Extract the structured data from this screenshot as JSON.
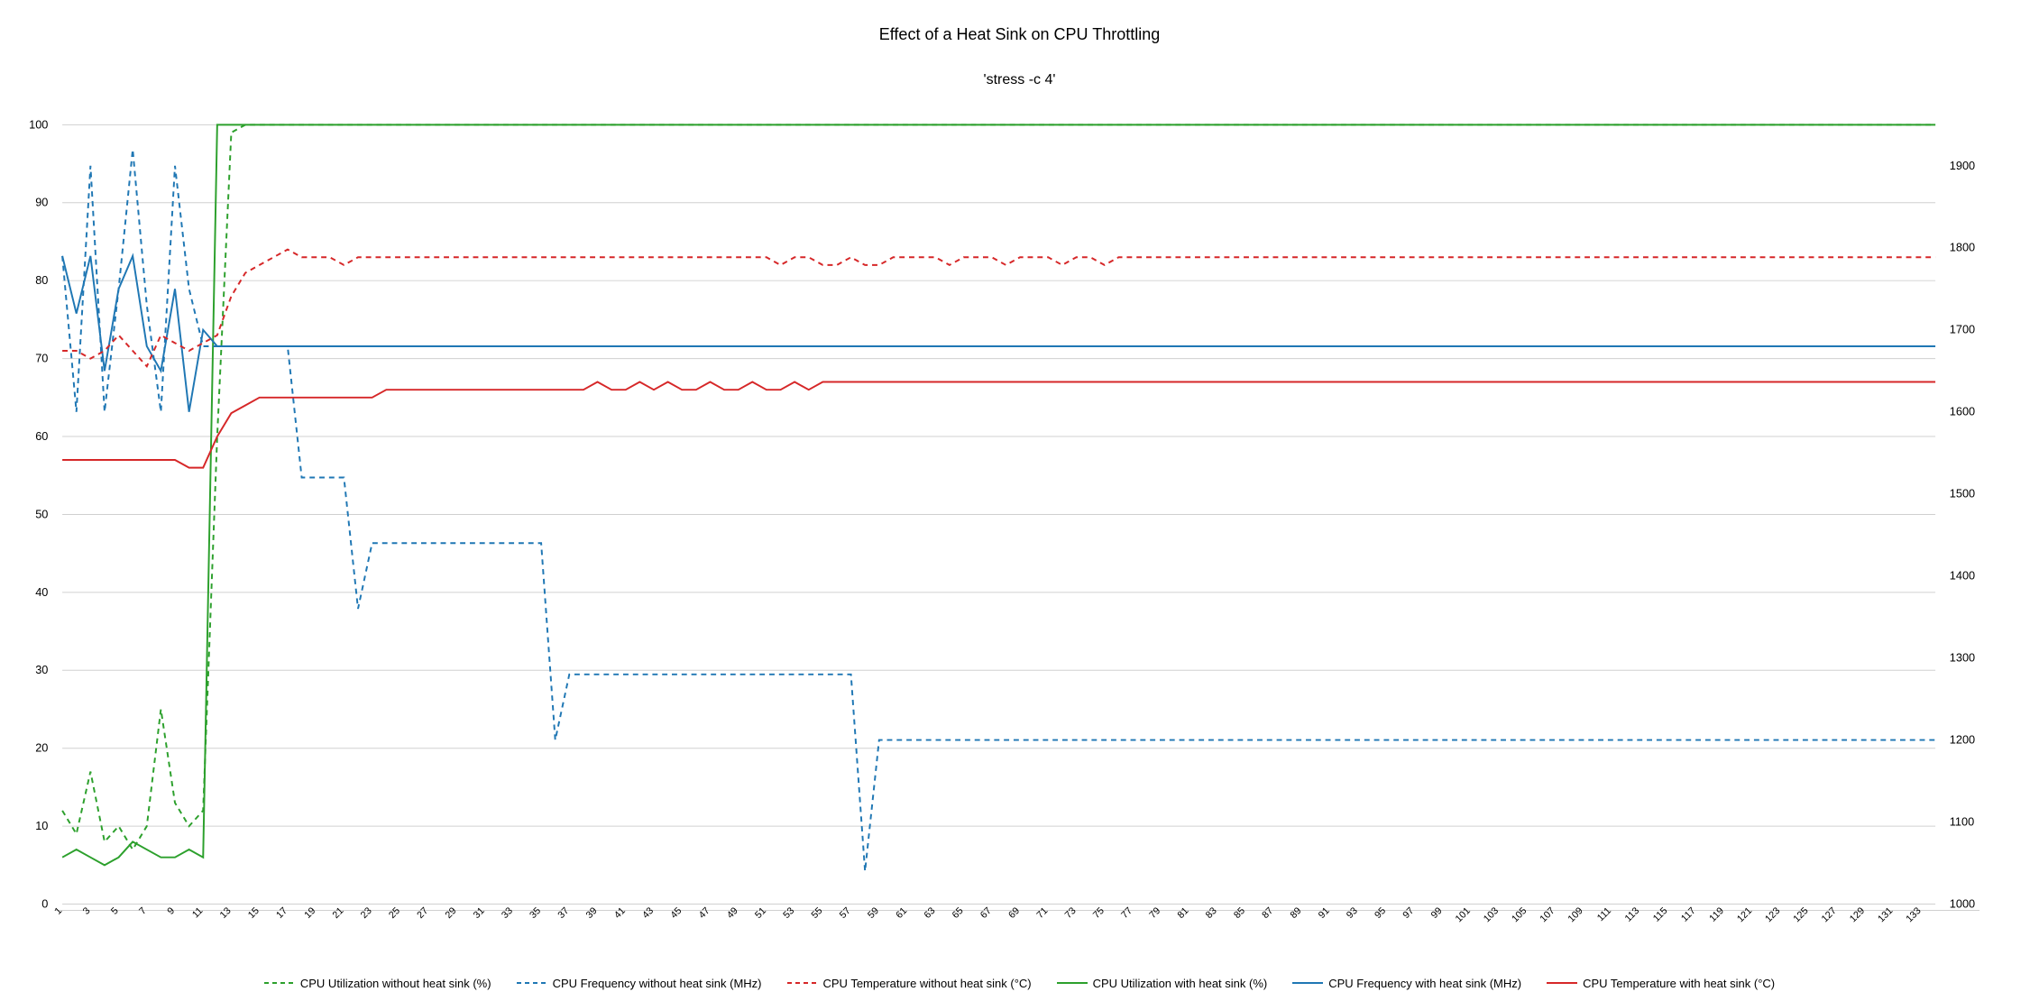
{
  "title": "Effect of a Heat Sink on CPU Throttling",
  "subtitle": "'stress -c 4'",
  "legend": [
    {
      "name": "CPU Utilization without heat sink (%)",
      "color": "#2ca02c",
      "dash": true
    },
    {
      "name": "CPU Frequency without heat sink (MHz)",
      "color": "#1f77b4",
      "dash": true
    },
    {
      "name": "CPU Temperature without heat sink (°C)",
      "color": "#d62728",
      "dash": true
    },
    {
      "name": "CPU Utilization with heat sink (%)",
      "color": "#2ca02c",
      "dash": false
    },
    {
      "name": "CPU Frequency with heat sink (MHz)",
      "color": "#1f77b4",
      "dash": false
    },
    {
      "name": "CPU Temperature with heat sink (°C)",
      "color": "#d62728",
      "dash": false
    }
  ],
  "chart_data": {
    "type": "line",
    "xlabel": "",
    "ylabel_left": "",
    "ylabel_right": "",
    "y_left": {
      "min": 0,
      "max": 100,
      "ticks": [
        0,
        10,
        20,
        30,
        40,
        50,
        60,
        70,
        80,
        90,
        100
      ]
    },
    "y_right": {
      "min": 1000,
      "max": 1950,
      "ticks": [
        1000,
        1100,
        1200,
        1300,
        1400,
        1500,
        1600,
        1700,
        1800,
        1900
      ]
    },
    "x": [
      1,
      2,
      3,
      4,
      5,
      6,
      7,
      8,
      9,
      10,
      11,
      12,
      13,
      14,
      15,
      16,
      17,
      18,
      19,
      20,
      21,
      22,
      23,
      24,
      25,
      26,
      27,
      28,
      29,
      30,
      31,
      32,
      33,
      34,
      35,
      36,
      37,
      38,
      39,
      40,
      41,
      42,
      43,
      44,
      45,
      46,
      47,
      48,
      49,
      50,
      51,
      52,
      53,
      54,
      55,
      56,
      57,
      58,
      59,
      60,
      61,
      62,
      63,
      64,
      65,
      66,
      67,
      68,
      69,
      70,
      71,
      72,
      73,
      74,
      75,
      76,
      77,
      78,
      79,
      80,
      81,
      82,
      83,
      84,
      85,
      86,
      87,
      88,
      89,
      90,
      91,
      92,
      93,
      94,
      95,
      96,
      97,
      98,
      99,
      100,
      101,
      102,
      103,
      104,
      105,
      106,
      107,
      108,
      109,
      110,
      111,
      112,
      113,
      114,
      115,
      116,
      117,
      118,
      119,
      120,
      121,
      122,
      123,
      124,
      125,
      126,
      127,
      128,
      129,
      130,
      131,
      132,
      133,
      134
    ],
    "series": [
      {
        "name": "CPU Utilization without heat sink (%)",
        "axis": "left",
        "color": "#2ca02c",
        "dash": true,
        "values": [
          12,
          9,
          17,
          8,
          10,
          7,
          10,
          25,
          13,
          10,
          12,
          60,
          99,
          100,
          100,
          100,
          100,
          100,
          100,
          100,
          100,
          100,
          100,
          100,
          100,
          100,
          100,
          100,
          100,
          100,
          100,
          100,
          100,
          100,
          100,
          100,
          100,
          100,
          100,
          100,
          100,
          100,
          100,
          100,
          100,
          100,
          100,
          100,
          100,
          100,
          100,
          100,
          100,
          100,
          100,
          100,
          100,
          100,
          100,
          100,
          100,
          100,
          100,
          100,
          100,
          100,
          100,
          100,
          100,
          100,
          100,
          100,
          100,
          100,
          100,
          100,
          100,
          100,
          100,
          100,
          100,
          100,
          100,
          100,
          100,
          100,
          100,
          100,
          100,
          100,
          100,
          100,
          100,
          100,
          100,
          100,
          100,
          100,
          100,
          100,
          100,
          100,
          100,
          100,
          100,
          100,
          100,
          100,
          100,
          100,
          100,
          100,
          100,
          100,
          100,
          100,
          100,
          100,
          100,
          100,
          100,
          100,
          100,
          100,
          100,
          100,
          100,
          100,
          100,
          100,
          100,
          100,
          100,
          100
        ]
      },
      {
        "name": "CPU Utilization with heat sink (%)",
        "axis": "left",
        "color": "#2ca02c",
        "dash": false,
        "values": [
          6,
          7,
          6,
          5,
          6,
          8,
          7,
          6,
          6,
          7,
          6,
          100,
          100,
          100,
          100,
          100,
          100,
          100,
          100,
          100,
          100,
          100,
          100,
          100,
          100,
          100,
          100,
          100,
          100,
          100,
          100,
          100,
          100,
          100,
          100,
          100,
          100,
          100,
          100,
          100,
          100,
          100,
          100,
          100,
          100,
          100,
          100,
          100,
          100,
          100,
          100,
          100,
          100,
          100,
          100,
          100,
          100,
          100,
          100,
          100,
          100,
          100,
          100,
          100,
          100,
          100,
          100,
          100,
          100,
          100,
          100,
          100,
          100,
          100,
          100,
          100,
          100,
          100,
          100,
          100,
          100,
          100,
          100,
          100,
          100,
          100,
          100,
          100,
          100,
          100,
          100,
          100,
          100,
          100,
          100,
          100,
          100,
          100,
          100,
          100,
          100,
          100,
          100,
          100,
          100,
          100,
          100,
          100,
          100,
          100,
          100,
          100,
          100,
          100,
          100,
          100,
          100,
          100,
          100,
          100,
          100,
          100,
          100,
          100,
          100,
          100,
          100,
          100,
          100,
          100,
          100,
          100,
          100,
          100
        ]
      },
      {
        "name": "CPU Frequency without heat sink (MHz)",
        "axis": "right",
        "color": "#1f77b4",
        "dash": true,
        "values": [
          1790,
          1600,
          1900,
          1600,
          1750,
          1920,
          1730,
          1600,
          1900,
          1750,
          1680,
          1680,
          1680,
          1680,
          1680,
          1680,
          1680,
          1520,
          1520,
          1520,
          1520,
          1360,
          1440,
          1440,
          1440,
          1440,
          1440,
          1440,
          1440,
          1440,
          1440,
          1440,
          1440,
          1440,
          1440,
          1200,
          1280,
          1280,
          1280,
          1280,
          1280,
          1280,
          1280,
          1280,
          1280,
          1280,
          1280,
          1280,
          1280,
          1280,
          1280,
          1280,
          1280,
          1280,
          1280,
          1280,
          1280,
          1040,
          1200,
          1200,
          1200,
          1200,
          1200,
          1200,
          1200,
          1200,
          1200,
          1200,
          1200,
          1200,
          1200,
          1200,
          1200,
          1200,
          1200,
          1200,
          1200,
          1200,
          1200,
          1200,
          1200,
          1200,
          1200,
          1200,
          1200,
          1200,
          1200,
          1200,
          1200,
          1200,
          1200,
          1200,
          1200,
          1200,
          1200,
          1200,
          1200,
          1200,
          1200,
          1200,
          1200,
          1200,
          1200,
          1200,
          1200,
          1200,
          1200,
          1200,
          1200,
          1200,
          1200,
          1200,
          1200,
          1200,
          1200,
          1200,
          1200,
          1200,
          1200,
          1200,
          1200,
          1200,
          1200,
          1200,
          1200,
          1200,
          1200,
          1200,
          1200,
          1200,
          1200,
          1200,
          1200,
          1200
        ]
      },
      {
        "name": "CPU Frequency with heat sink (MHz)",
        "axis": "right",
        "color": "#1f77b4",
        "dash": false,
        "values": [
          1790,
          1720,
          1790,
          1650,
          1750,
          1790,
          1680,
          1650,
          1750,
          1600,
          1700,
          1680,
          1680,
          1680,
          1680,
          1680,
          1680,
          1680,
          1680,
          1680,
          1680,
          1680,
          1680,
          1680,
          1680,
          1680,
          1680,
          1680,
          1680,
          1680,
          1680,
          1680,
          1680,
          1680,
          1680,
          1680,
          1680,
          1680,
          1680,
          1680,
          1680,
          1680,
          1680,
          1680,
          1680,
          1680,
          1680,
          1680,
          1680,
          1680,
          1680,
          1680,
          1680,
          1680,
          1680,
          1680,
          1680,
          1680,
          1680,
          1680,
          1680,
          1680,
          1680,
          1680,
          1680,
          1680,
          1680,
          1680,
          1680,
          1680,
          1680,
          1680,
          1680,
          1680,
          1680,
          1680,
          1680,
          1680,
          1680,
          1680,
          1680,
          1680,
          1680,
          1680,
          1680,
          1680,
          1680,
          1680,
          1680,
          1680,
          1680,
          1680,
          1680,
          1680,
          1680,
          1680,
          1680,
          1680,
          1680,
          1680,
          1680,
          1680,
          1680,
          1680,
          1680,
          1680,
          1680,
          1680,
          1680,
          1680,
          1680,
          1680,
          1680,
          1680,
          1680,
          1680,
          1680,
          1680,
          1680,
          1680,
          1680,
          1680,
          1680,
          1680,
          1680,
          1680,
          1680,
          1680,
          1680,
          1680,
          1680,
          1680,
          1680,
          1680
        ]
      },
      {
        "name": "CPU Temperature without heat sink (°C)",
        "axis": "left",
        "color": "#d62728",
        "dash": true,
        "values": [
          71,
          71,
          70,
          71,
          73,
          71,
          69,
          73,
          72,
          71,
          72,
          73,
          78,
          81,
          82,
          83,
          84,
          83,
          83,
          83,
          82,
          83,
          83,
          83,
          83,
          83,
          83,
          83,
          83,
          83,
          83,
          83,
          83,
          83,
          83,
          83,
          83,
          83,
          83,
          83,
          83,
          83,
          83,
          83,
          83,
          83,
          83,
          83,
          83,
          83,
          83,
          82,
          83,
          83,
          82,
          82,
          83,
          82,
          82,
          83,
          83,
          83,
          83,
          82,
          83,
          83,
          83,
          82,
          83,
          83,
          83,
          82,
          83,
          83,
          82,
          83,
          83,
          83,
          83,
          83,
          83,
          83,
          83,
          83,
          83,
          83,
          83,
          83,
          83,
          83,
          83,
          83,
          83,
          83,
          83,
          83,
          83,
          83,
          83,
          83,
          83,
          83,
          83,
          83,
          83,
          83,
          83,
          83,
          83,
          83,
          83,
          83,
          83,
          83,
          83,
          83,
          83,
          83,
          83,
          83,
          83,
          83,
          83,
          83,
          83,
          83,
          83,
          83,
          83,
          83,
          83,
          83,
          83,
          83
        ]
      },
      {
        "name": "CPU Temperature with heat sink (°C)",
        "axis": "left",
        "color": "#d62728",
        "dash": false,
        "values": [
          57,
          57,
          57,
          57,
          57,
          57,
          57,
          57,
          57,
          56,
          56,
          60,
          63,
          64,
          65,
          65,
          65,
          65,
          65,
          65,
          65,
          65,
          65,
          66,
          66,
          66,
          66,
          66,
          66,
          66,
          66,
          66,
          66,
          66,
          66,
          66,
          66,
          66,
          67,
          66,
          66,
          67,
          66,
          67,
          66,
          66,
          67,
          66,
          66,
          67,
          66,
          66,
          67,
          66,
          67,
          67,
          67,
          67,
          67,
          67,
          67,
          67,
          67,
          67,
          67,
          67,
          67,
          67,
          67,
          67,
          67,
          67,
          67,
          67,
          67,
          67,
          67,
          67,
          67,
          67,
          67,
          67,
          67,
          67,
          67,
          67,
          67,
          67,
          67,
          67,
          67,
          67,
          67,
          67,
          67,
          67,
          67,
          67,
          67,
          67,
          67,
          67,
          67,
          67,
          67,
          67,
          67,
          67,
          67,
          67,
          67,
          67,
          67,
          67,
          67,
          67,
          67,
          67,
          67,
          67,
          67,
          67,
          67,
          67,
          67,
          67,
          67,
          67,
          67,
          67,
          67,
          67,
          67,
          67
        ]
      }
    ]
  }
}
